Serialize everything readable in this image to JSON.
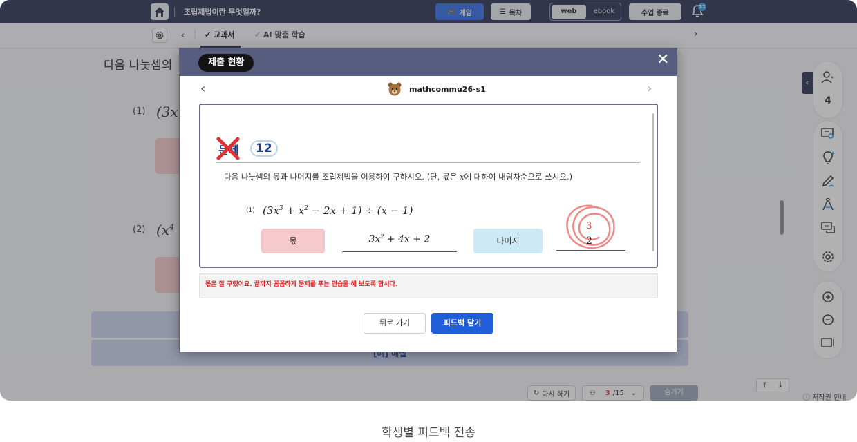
{
  "caption": "학생별 피드백 전송",
  "topbar": {
    "title": "조립제법이란 무엇일까?",
    "game_label": "게임",
    "toc_label": "목차",
    "web_label": "web",
    "ebook_label": "ebook",
    "end_label": "수업 종료",
    "notification_count": "31"
  },
  "subbar": {
    "tab_textbook": "교과서",
    "tab_ai": "AI 맞춤 학습"
  },
  "background": {
    "question": "다음 나눗셈의",
    "p1_label": "(1)",
    "p1_math": "(3x",
    "p2_label": "(2)",
    "p2_math": "(x",
    "p2_sup": "4",
    "explanation_label": "[예] 예설"
  },
  "sidebar": {
    "student_count": "4",
    "icons": [
      "students-icon",
      "monitor-search-icon",
      "lightbulb-icon",
      "pen-icon",
      "compass-icon",
      "chat-icon",
      "gear-icon",
      "zoom-in-icon",
      "zoom-out-icon",
      "screen-icon"
    ]
  },
  "bottombar": {
    "retry_label": "다시 하기",
    "pager_current": "3",
    "pager_total": "/15",
    "submit_label": "숨기기",
    "copyright_label": "저작권 안내"
  },
  "modal": {
    "title": "제출 현황",
    "student_id": "mathcommu26-s1",
    "problem_tag": "문제",
    "problem_number": "12",
    "problem_text_before": "다음 나눗셈의 몫과 나머지를 조립제법을 이용하여 구하시오. (단, 몫은 ",
    "problem_var": "x",
    "problem_text_after": "에 대하여 내림차순으로 쓰시오.)",
    "sub_label": "(1)",
    "sub_math_html_parts": {
      "a": "(3x",
      "b": "3",
      "c": " + x",
      "d": "2",
      "e": " − 2x + 1) ÷ (x − 1)"
    },
    "quotient_label": "몫",
    "quotient_answer_a": "3x",
    "quotient_answer_b": "2",
    "quotient_answer_c": " + 4x + 2",
    "remainder_label": "나머지",
    "remainder_correction": "3",
    "remainder_answer": "2",
    "feedback": "몫은 잘 구했어요. 끝까지 꼼꼼하게 문제를 푸는 연습을 해 보도록 합시다.",
    "back_label": "뒤로 가기",
    "close_label": "피드백 닫기",
    "colors": {
      "wrong": "#e03030",
      "primary": "#1f5ed8",
      "header": "#565d7e"
    }
  }
}
